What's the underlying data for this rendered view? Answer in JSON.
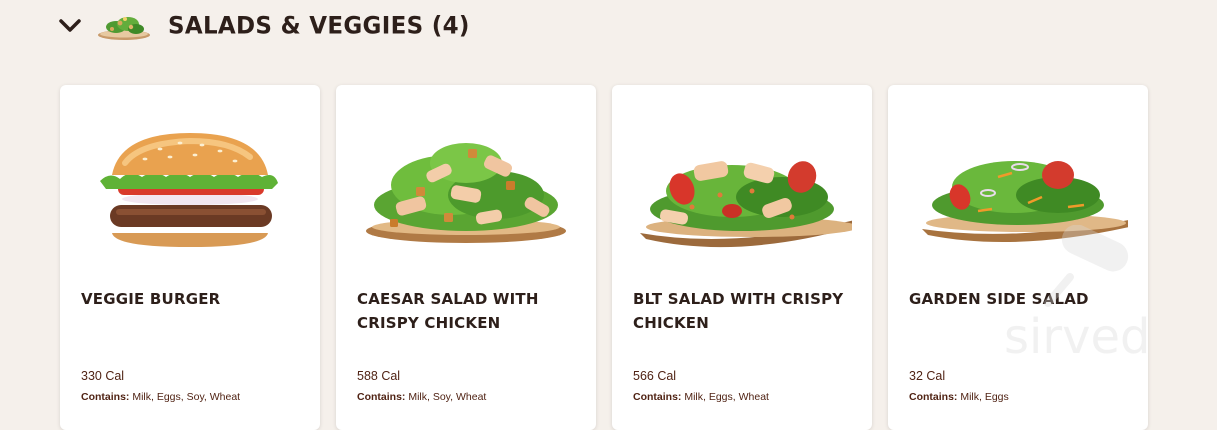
{
  "section": {
    "title": "SALADS & VEGGIES (4)",
    "chevron_icon": "chevron-down-icon",
    "thumb_icon": "salad-thumbnail"
  },
  "items": [
    {
      "name": "VEGGIE BURGER",
      "calories": "330 Cal",
      "contains_label": "Contains:",
      "allergens": "Milk, Eggs, Soy, Wheat",
      "image": "veggie-burger-image"
    },
    {
      "name": "CAESAR SALAD WITH CRISPY CHICKEN",
      "calories": "588 Cal",
      "contains_label": "Contains:",
      "allergens": "Milk, Soy, Wheat",
      "image": "caesar-salad-image"
    },
    {
      "name": "BLT SALAD WITH CRISPY CHICKEN",
      "calories": "566 Cal",
      "contains_label": "Contains:",
      "allergens": "Milk, Eggs, Wheat",
      "image": "blt-salad-image"
    },
    {
      "name": "GARDEN SIDE SALAD",
      "calories": "32 Cal",
      "contains_label": "Contains:",
      "allergens": "Milk, Eggs",
      "image": "garden-salad-image"
    }
  ],
  "watermark": {
    "text": "sirved"
  },
  "colors": {
    "background": "#f5f0eb",
    "text_brown": "#502314",
    "heading": "#2d1f1a"
  }
}
